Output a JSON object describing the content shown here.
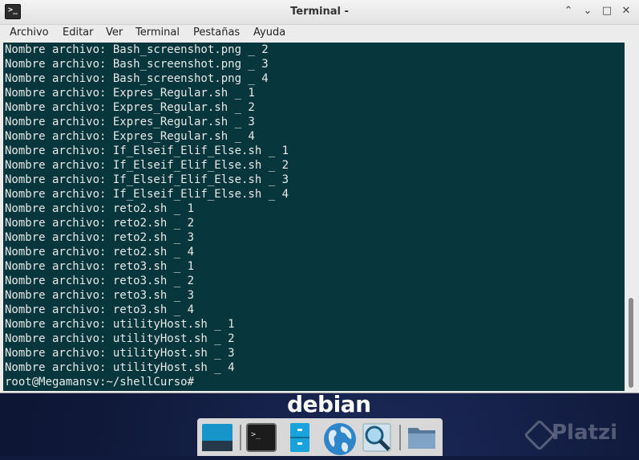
{
  "window": {
    "title": "Terminal -",
    "controls": {
      "up": "⌃",
      "down": "⌄",
      "maximize": "□",
      "close": "✕"
    }
  },
  "menu": [
    "Archivo",
    "Editar",
    "Ver",
    "Terminal",
    "Pestañas",
    "Ayuda"
  ],
  "terminal": {
    "lines": [
      "Nombre archivo: Bash_screenshot.png _ 2",
      "Nombre archivo: Bash_screenshot.png _ 3",
      "Nombre archivo: Bash_screenshot.png _ 4",
      "Nombre archivo: Expres_Regular.sh _ 1",
      "Nombre archivo: Expres_Regular.sh _ 2",
      "Nombre archivo: Expres_Regular.sh _ 3",
      "Nombre archivo: Expres_Regular.sh _ 4",
      "Nombre archivo: If_Elseif_Elif_Else.sh _ 1",
      "Nombre archivo: If_Elseif_Elif_Else.sh _ 2",
      "Nombre archivo: If_Elseif_Elif_Else.sh _ 3",
      "Nombre archivo: If_Elseif_Elif_Else.sh _ 4",
      "Nombre archivo: reto2.sh _ 1",
      "Nombre archivo: reto2.sh _ 2",
      "Nombre archivo: reto2.sh _ 3",
      "Nombre archivo: reto2.sh _ 4",
      "Nombre archivo: reto3.sh _ 1",
      "Nombre archivo: reto3.sh _ 2",
      "Nombre archivo: reto3.sh _ 3",
      "Nombre archivo: reto3.sh _ 4",
      "Nombre archivo: utilityHost.sh _ 1",
      "Nombre archivo: utilityHost.sh _ 2",
      "Nombre archivo: utilityHost.sh _ 3",
      "Nombre archivo: utilityHost.sh _ 4",
      "root@Megamansv:~/shellCurso#"
    ],
    "background": "#07373c",
    "foreground": "#e8e8e8"
  },
  "desktop": {
    "logo_text": "debian",
    "watermark_text": "Platzi"
  },
  "dock": {
    "items": [
      "show-desktop-icon",
      "terminal-icon",
      "file-manager-icon",
      "web-browser-icon",
      "app-finder-icon",
      "folder-icon"
    ]
  }
}
